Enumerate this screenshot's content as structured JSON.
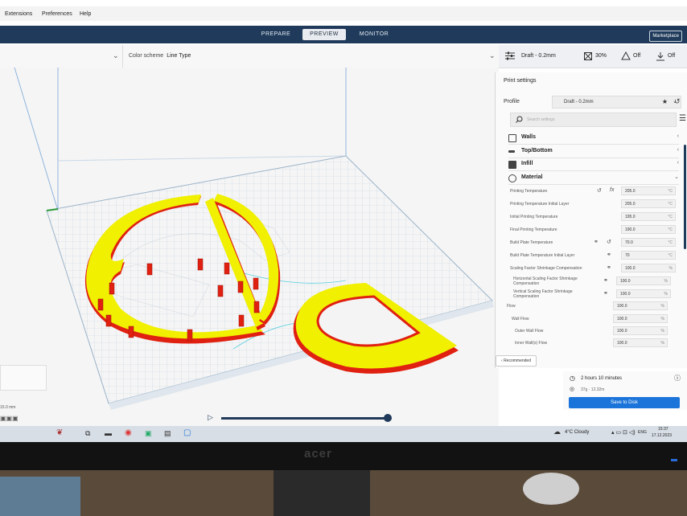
{
  "menu": {
    "extensions": "Extensions",
    "preferences": "Preferences",
    "help": "Help"
  },
  "stages": {
    "prepare": "PREPARE",
    "preview": "PREVIEW",
    "monitor": "MONITOR",
    "marketplace": "Marketplace"
  },
  "header": {
    "color_scheme_label": "Color scheme",
    "color_scheme_value": "Line Type",
    "profile_summary": "Draft - 0.2mm",
    "infill": "30%",
    "support": "Off",
    "adhesion": "Off"
  },
  "panel": {
    "title": "Print settings",
    "profile_label": "Profile",
    "profile_value": "Draft - 0.2mm",
    "search_placeholder": "Search settings",
    "categories": [
      {
        "label": "Walls"
      },
      {
        "label": "Top/Bottom"
      },
      {
        "label": "Infill"
      },
      {
        "label": "Material"
      }
    ],
    "settings": [
      {
        "label": "Printing Temperature",
        "value": "205.0",
        "unit": "°C"
      },
      {
        "label": "Printing Temperature Initial Layer",
        "value": "205.0",
        "unit": "°C"
      },
      {
        "label": "Initial Printing Temperature",
        "value": "195.0",
        "unit": "°C"
      },
      {
        "label": "Final Printing Temperature",
        "value": "190.0",
        "unit": "°C"
      },
      {
        "label": "Build Plate Temperature",
        "value": "70.0",
        "unit": "°C"
      },
      {
        "label": "Build Plate Temperature Initial Layer",
        "value": "70",
        "unit": "°C"
      },
      {
        "label": "Scaling Factor Shrinkage Compensation",
        "value": "100.0",
        "unit": "%"
      },
      {
        "label": "Horizontal Scaling Factor Shrinkage Compensation",
        "value": "100.0",
        "unit": "%"
      },
      {
        "label": "Vertical Scaling Factor Shrinkage Compensation",
        "value": "100.0",
        "unit": "%"
      },
      {
        "label": "Flow",
        "value": "100.0",
        "unit": "%"
      },
      {
        "label": "Wall Flow",
        "value": "100.0",
        "unit": "%"
      },
      {
        "label": "Outer Wall Flow",
        "value": "100.0",
        "unit": "%"
      },
      {
        "label": "Inner Wall(s) Flow",
        "value": "100.0",
        "unit": "%"
      }
    ],
    "recommended": "Recommended"
  },
  "estimate": {
    "time": "2 hours 10 minutes",
    "material": "37g · 12.32m",
    "save": "Save to Disk"
  },
  "viewport": {
    "dimension": "15.0 mm"
  },
  "taskbar": {
    "weather": "4°C Cloudy",
    "lang": "ENG",
    "time": "15:37",
    "date": "17.12.2023"
  },
  "brand": "acer",
  "colors": {
    "accent": "#1a74d9",
    "model_fill": "#f2f200",
    "model_wall": "#e02010",
    "stage_bar": "#1f3a5a"
  }
}
